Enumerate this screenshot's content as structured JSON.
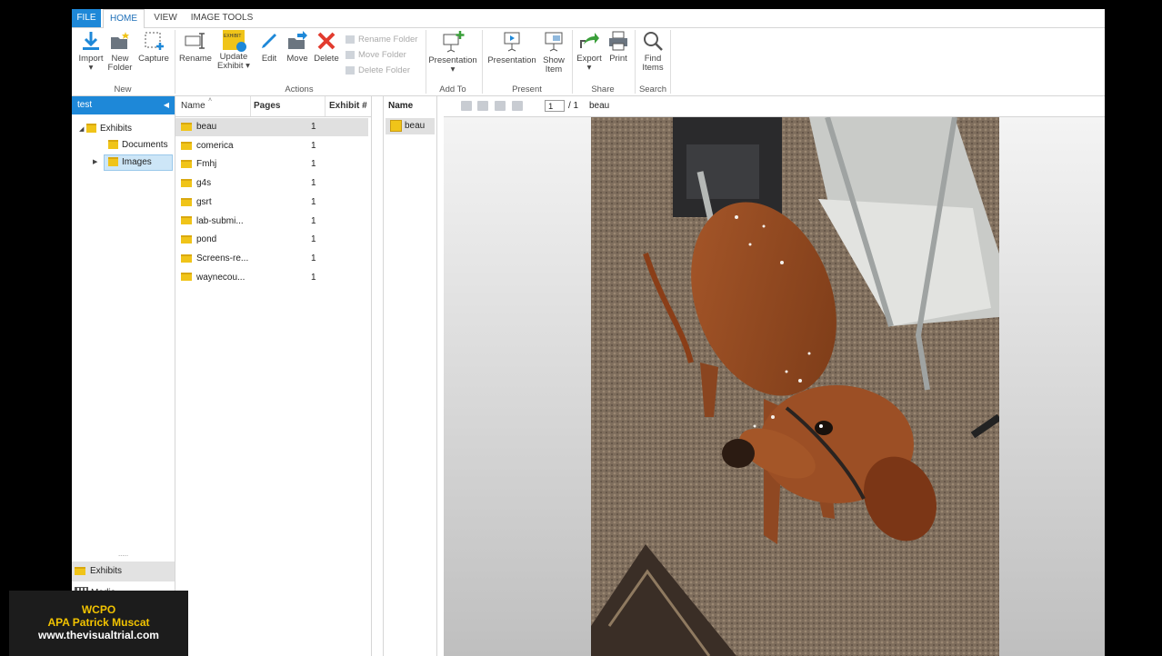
{
  "tabs": [
    "FILE",
    "HOME",
    "VIEW",
    "IMAGE TOOLS"
  ],
  "ribbon": {
    "new_group": {
      "label": "New",
      "buttons": [
        "Import",
        "New Folder",
        "Capture"
      ]
    },
    "actions_group": {
      "label": "Actions",
      "buttons": [
        "Rename",
        "Update Exhibit",
        "Edit",
        "Move",
        "Delete"
      ],
      "small": [
        "Rename Folder",
        "Move Folder",
        "Delete Folder"
      ]
    },
    "addto_group": {
      "label": "Add To",
      "buttons": [
        "Presentation"
      ]
    },
    "present_group": {
      "label": "Present",
      "buttons": [
        "Presentation",
        "Show Item"
      ]
    },
    "share_group": {
      "label": "Share",
      "buttons": [
        "Export",
        "Print"
      ]
    },
    "search_group": {
      "label": "Search",
      "buttons": [
        "Find Items"
      ]
    },
    "exhibit_icon_text": "EXHIBIT"
  },
  "left_panel": {
    "case_name": "test",
    "tree": [
      {
        "label": "Exhibits"
      },
      {
        "label": "Documents"
      },
      {
        "label": "Images"
      }
    ],
    "nav": [
      "Exhibits",
      "Media"
    ],
    "splitter": "....."
  },
  "list": {
    "columns": [
      "Name",
      "Pages",
      "Exhibit #"
    ],
    "rows": [
      {
        "name": "beau",
        "pages": "1"
      },
      {
        "name": "comerica",
        "pages": "1"
      },
      {
        "name": "Fmhj",
        "pages": "1"
      },
      {
        "name": "g4s",
        "pages": "1"
      },
      {
        "name": "gsrt",
        "pages": "1"
      },
      {
        "name": "lab-submi...",
        "pages": "1"
      },
      {
        "name": "pond",
        "pages": "1"
      },
      {
        "name": "Screens-re...",
        "pages": "1"
      },
      {
        "name": "waynecou...",
        "pages": "1"
      }
    ]
  },
  "pages_panel": {
    "header": "Name",
    "item": "beau"
  },
  "viewer": {
    "page_current": "1",
    "page_total": "/ 1",
    "doc_name": "beau"
  },
  "watermark": {
    "line1": "WCPO",
    "line2": "APA Patrick Muscat",
    "line3": "www.thevisualtrial.com"
  },
  "colors": {
    "accent": "#1e88d8",
    "folder": "#f0c419",
    "delete": "#e23b2e",
    "arrow": "#3a9f3a"
  }
}
